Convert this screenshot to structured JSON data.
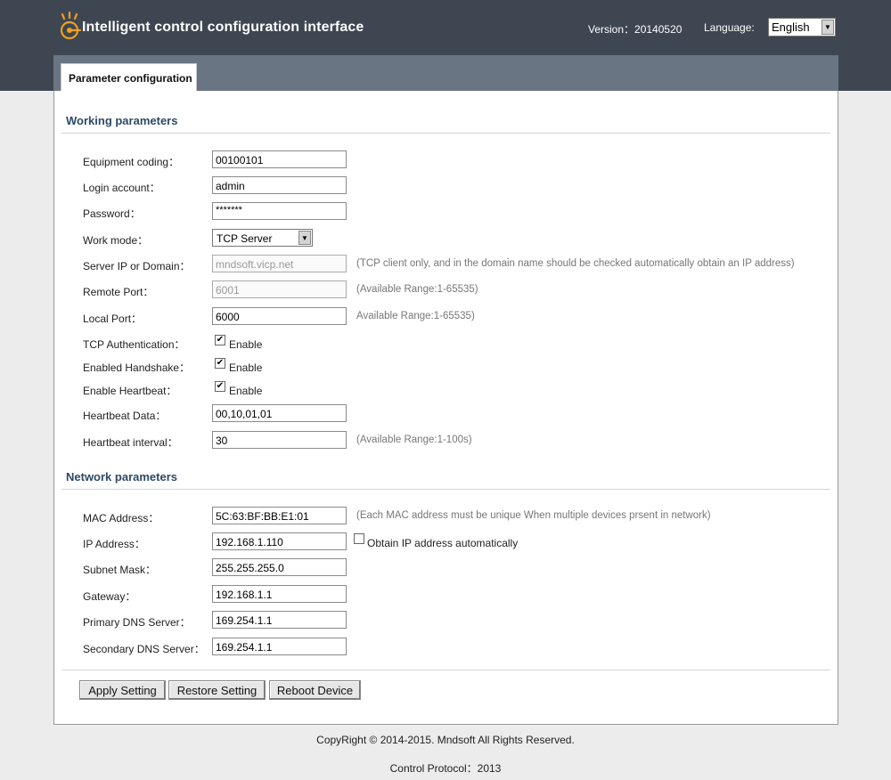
{
  "header": {
    "title": "Intelligent control configuration interface",
    "version_label": "Version：20140520",
    "language_label": "Language:",
    "language_value": "English"
  },
  "tab": {
    "label": "Parameter configuration"
  },
  "working": {
    "title": "Working parameters",
    "equipment_coding": {
      "label": "Equipment coding：",
      "value": "00100101"
    },
    "login_account": {
      "label": "Login account：",
      "value": "admin"
    },
    "password": {
      "label": "Password：",
      "value": "*******"
    },
    "work_mode": {
      "label": "Work mode：",
      "value": "TCP Server"
    },
    "server_ip": {
      "label": "Server IP or Domain：",
      "value": "mndsoft.vicp.net",
      "hint": "(TCP client only, and in the domain name should be checked automatically obtain an IP address)"
    },
    "remote_port": {
      "label": "Remote Port：",
      "value": "6001",
      "hint": "(Available Range:1-65535)"
    },
    "local_port": {
      "label": "Local Port：",
      "value": "6000",
      "hint": "Available Range:1-65535)"
    },
    "tcp_auth": {
      "label": "TCP Authentication：",
      "check_label": "Enable",
      "checked": true
    },
    "handshake": {
      "label": "Enabled Handshake：",
      "check_label": "Enable",
      "checked": true
    },
    "heartbeat": {
      "label": "Enable Heartbeat：",
      "check_label": "Enable",
      "checked": true
    },
    "heartbeat_data": {
      "label": "Heartbeat Data：",
      "value": "00,10,01,01"
    },
    "heartbeat_interval": {
      "label": "Heartbeat interval：",
      "value": "30",
      "hint": "(Available Range:1-100s)"
    }
  },
  "network": {
    "title": "Network parameters",
    "mac": {
      "label": "MAC Address：",
      "value": "5C:63:BF:BB:E1:01",
      "hint": "(Each MAC address must be unique When multiple devices prsent in network)"
    },
    "ip": {
      "label": "IP Address：",
      "value": "192.168.1.110",
      "check_label": "Obtain IP address automatically",
      "checked": false
    },
    "subnet": {
      "label": "Subnet Mask：",
      "value": "255.255.255.0"
    },
    "gateway": {
      "label": "Gateway：",
      "value": "192.168.1.1"
    },
    "dns1": {
      "label": "Primary DNS Server：",
      "value": "169.254.1.1"
    },
    "dns2": {
      "label": "Secondary DNS Server：",
      "value": "169.254.1.1"
    }
  },
  "buttons": {
    "apply": "Apply Setting",
    "restore": "Restore Setting",
    "reboot": "Reboot Device"
  },
  "footer": {
    "copyright": "CopyRight © 2014-2015. Mndsoft All Rights Reserved.",
    "protocol": "Control Protocol：2013"
  },
  "colors": {
    "topbar": "#3d4651",
    "subbar": "#697582",
    "logo": "#f0a020",
    "section_title": "#2e4a66"
  }
}
